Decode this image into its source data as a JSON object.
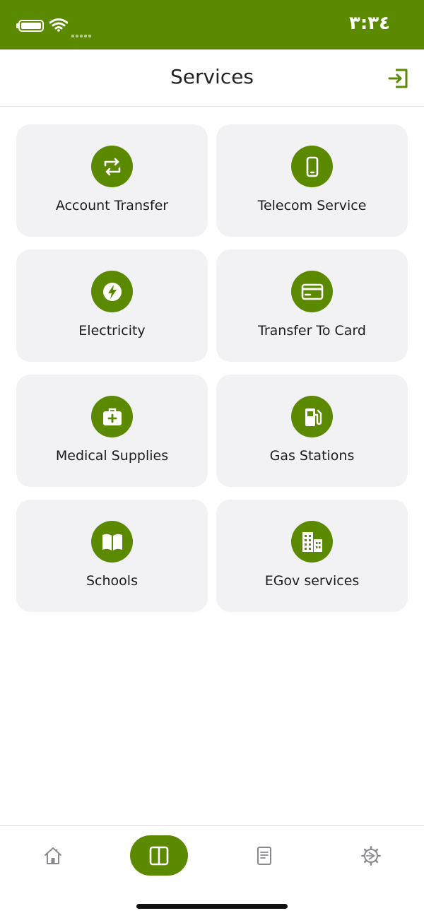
{
  "status_bar": {
    "time": "٣:٣٤",
    "background": "#5b8a00"
  },
  "header": {
    "title": "Services",
    "action_icon": "logout-icon"
  },
  "services": [
    {
      "label": "Account Transfer",
      "icon": "transfer-arrows-icon"
    },
    {
      "label": "Telecom Service",
      "icon": "smartphone-icon"
    },
    {
      "label": "Electricity",
      "icon": "lightning-bolt-icon"
    },
    {
      "label": "Transfer To Card",
      "icon": "credit-card-icon"
    },
    {
      "label": "Medical Supplies",
      "icon": "first-aid-kit-icon"
    },
    {
      "label": "Gas Stations",
      "icon": "fuel-pump-icon"
    },
    {
      "label": "Schools",
      "icon": "open-book-icon"
    },
    {
      "label": "EGov services",
      "icon": "buildings-icon"
    }
  ],
  "tab_bar": {
    "tabs": [
      {
        "icon": "home-icon",
        "active": false
      },
      {
        "icon": "services-grid-icon",
        "active": true
      },
      {
        "icon": "document-icon",
        "active": false
      },
      {
        "icon": "settings-gear-icon",
        "active": false
      }
    ]
  },
  "colors": {
    "accent": "#5b8a00",
    "card_background": "#f2f2f4",
    "inactive_icon": "#8a8a8e"
  }
}
